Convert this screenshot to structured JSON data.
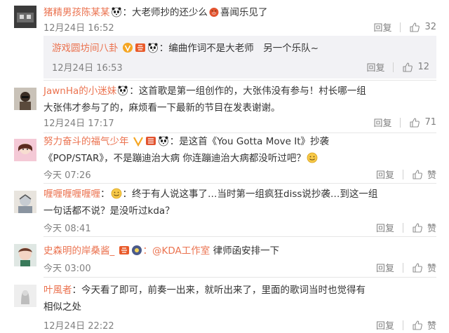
{
  "comments": [
    {
      "username": "猪精男孩陈某某",
      "text_a": "：大老师抄的还少么",
      "text_b": "喜闻乐见了",
      "time": "12月24日 16:52",
      "reply_label": "回复",
      "likes": "32",
      "reply": {
        "username": "游戏圆坊间八卦",
        "text": "：编曲作词不是大老师　另一个乐队~",
        "time": "12月24日 16:53",
        "reply_label": "回复",
        "likes": "12"
      }
    },
    {
      "username": "JawnHa的小迷妹",
      "line1": "：这首歌是第一组创作的，大张伟没有参与！村长哪一组",
      "line2": "大张伟才参与了的，麻烦看一下最新的节目在发表谢谢。",
      "time": "12月24日 17:17",
      "reply_label": "回复",
      "likes": "71"
    },
    {
      "username": "努力奋斗的福气少年",
      "line1": "：是这首《You Gotta Move It》抄袭",
      "line2": "《POP/STAR》，不是蹦迪治大病 你连蹦迪治大病都没听过吧？",
      "time": "今天 07:26",
      "reply_label": "回复",
      "likes": "赞"
    },
    {
      "username": "喱喱喱喱喱喱",
      "line1": "：终于有人说这事了…当时第一组疯狂diss说抄袭…到这一组",
      "line2": "一句话都不说？是没听过kda？",
      "time": "今天 08:41",
      "reply_label": "回复",
      "likes": "赞"
    },
    {
      "username": "史森明的岸桑酱_",
      "mention": "：@KDA工作室",
      "text": " 律师函安排一下",
      "time": "今天 03:00",
      "reply_label": "回复",
      "likes": "赞"
    },
    {
      "username": "叶風者",
      "line1": "：今天看了即可，前奏一出来，就听出来了，里面的歌词当时也觉得有",
      "line2": "相似之处",
      "time": "12月24日 22:22",
      "reply_label": "回复",
      "likes": "赞"
    }
  ],
  "colors": {
    "username": "#eb7350",
    "meta": "#808080",
    "reply_bg": "#f2f2f5"
  },
  "icons": [
    "panda-emoji",
    "pig-emoji",
    "v-badge",
    "fans-badge",
    "smile-emoji",
    "thumb-up-icon"
  ]
}
